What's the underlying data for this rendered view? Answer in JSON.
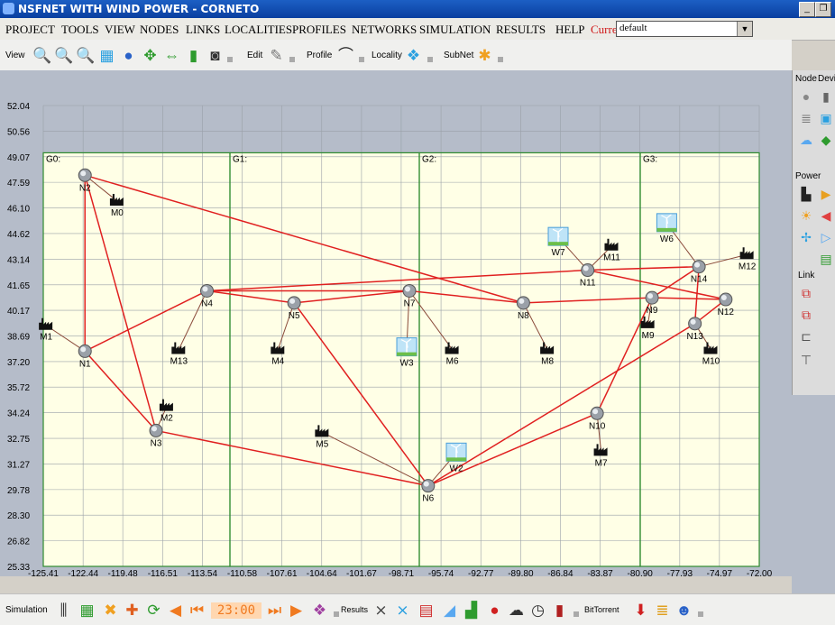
{
  "window": {
    "title": "NSFNET WITH WIND POWER - CORNETO"
  },
  "menu": {
    "items": [
      "PROJECT",
      "TOOLS",
      "VIEW",
      "NODES",
      "LINKS",
      "LOCALITIES",
      "PROFILES",
      "NETWORKS",
      "SIMULATION",
      "RESULTS",
      "HELP"
    ],
    "current_network_label": "Current Network",
    "current_network_value": "default"
  },
  "toolbar": {
    "view_label": "View",
    "edit_label": "Edit",
    "profile_label": "Profile",
    "locality_label": "Locality",
    "subnet_label": "SubNet"
  },
  "side_panel": {
    "node_tab": "Node",
    "device_tab": "Devi",
    "power_label": "Power",
    "link_label": "Link"
  },
  "bottom": {
    "simulation_label": "Simulation",
    "timer_display": "23:00",
    "results_label": "Results",
    "bittorrent_label": "BitTorrent"
  },
  "map": {
    "y_ticks": [
      "52.04",
      "50.56",
      "49.07",
      "47.59",
      "46.10",
      "44.62",
      "43.14",
      "41.65",
      "40.17",
      "38.69",
      "37.20",
      "35.72",
      "34.24",
      "32.75",
      "31.27",
      "29.78",
      "28.30",
      "26.82",
      "25.33"
    ],
    "x_ticks": [
      "-125.41",
      "-122.44",
      "-119.48",
      "-116.51",
      "-113.54",
      "-110.58",
      "-107.61",
      "-104.64",
      "-101.67",
      "-98.71",
      "-95.74",
      "-92.77",
      "-89.80",
      "-86.84",
      "-83.87",
      "-80.90",
      "-77.93",
      "-74.97",
      "-72.00"
    ],
    "groups": [
      "G0:",
      "G1:",
      "G2:",
      "G3:"
    ],
    "nodes": [
      {
        "id": "N1",
        "lon": -122.3,
        "lat": 37.8
      },
      {
        "id": "N2",
        "lon": -122.3,
        "lat": 48.0
      },
      {
        "id": "N3",
        "lon": -117.0,
        "lat": 33.2
      },
      {
        "id": "N4",
        "lon": -113.2,
        "lat": 41.3
      },
      {
        "id": "N5",
        "lon": -106.7,
        "lat": 40.6
      },
      {
        "id": "N6",
        "lon": -96.7,
        "lat": 30.0
      },
      {
        "id": "N7",
        "lon": -98.1,
        "lat": 41.3
      },
      {
        "id": "N8",
        "lon": -89.6,
        "lat": 40.6
      },
      {
        "id": "N9",
        "lon": -80.0,
        "lat": 40.9
      },
      {
        "id": "N10",
        "lon": -84.1,
        "lat": 34.2
      },
      {
        "id": "N11",
        "lon": -84.8,
        "lat": 42.5
      },
      {
        "id": "N12",
        "lon": -74.5,
        "lat": 40.8
      },
      {
        "id": "N13",
        "lon": -76.8,
        "lat": 39.4
      },
      {
        "id": "N14",
        "lon": -76.5,
        "lat": 42.7
      }
    ],
    "power_plants": [
      {
        "id": "M0",
        "lon": -119.9,
        "lat": 46.5
      },
      {
        "id": "M1",
        "lon": -125.2,
        "lat": 39.3
      },
      {
        "id": "M2",
        "lon": -116.2,
        "lat": 34.6
      },
      {
        "id": "M4",
        "lon": -107.9,
        "lat": 37.9
      },
      {
        "id": "M5",
        "lon": -104.6,
        "lat": 33.1
      },
      {
        "id": "M6",
        "lon": -94.9,
        "lat": 37.9
      },
      {
        "id": "M7",
        "lon": -83.8,
        "lat": 32.0
      },
      {
        "id": "M8",
        "lon": -87.8,
        "lat": 37.9
      },
      {
        "id": "M9",
        "lon": -80.3,
        "lat": 39.4
      },
      {
        "id": "M10",
        "lon": -75.6,
        "lat": 37.9
      },
      {
        "id": "M11",
        "lon": -83.0,
        "lat": 43.9
      },
      {
        "id": "M12",
        "lon": -72.9,
        "lat": 43.4
      },
      {
        "id": "M13",
        "lon": -115.3,
        "lat": 37.9
      }
    ],
    "wind_farms": [
      {
        "id": "W2",
        "lon": -94.6,
        "lat": 31.9
      },
      {
        "id": "W3",
        "lon": -98.3,
        "lat": 38.0
      },
      {
        "id": "W6",
        "lon": -78.9,
        "lat": 45.2
      },
      {
        "id": "W7",
        "lon": -87.0,
        "lat": 44.4
      }
    ],
    "links": [
      [
        "N1",
        "N2"
      ],
      [
        "N1",
        "N3"
      ],
      [
        "N1",
        "N4"
      ],
      [
        "N2",
        "N3"
      ],
      [
        "N2",
        "N8"
      ],
      [
        "N3",
        "N6"
      ],
      [
        "N4",
        "N5"
      ],
      [
        "N4",
        "N11"
      ],
      [
        "N4",
        "N7"
      ],
      [
        "N5",
        "N6"
      ],
      [
        "N5",
        "N7"
      ],
      [
        "N6",
        "N10"
      ],
      [
        "N6",
        "N13"
      ],
      [
        "N7",
        "N8"
      ],
      [
        "N8",
        "N9"
      ],
      [
        "N9",
        "N10"
      ],
      [
        "N9",
        "N12"
      ],
      [
        "N9",
        "N14"
      ],
      [
        "N11",
        "N12"
      ],
      [
        "N12",
        "N13"
      ],
      [
        "N13",
        "N14"
      ],
      [
        "N11",
        "N14"
      ]
    ],
    "feeders": [
      [
        "M0",
        "N2"
      ],
      [
        "M1",
        "N1"
      ],
      [
        "M2",
        "N3"
      ],
      [
        "M4",
        "N5"
      ],
      [
        "M5",
        "N6"
      ],
      [
        "M6",
        "N7"
      ],
      [
        "M7",
        "N10"
      ],
      [
        "M8",
        "N8"
      ],
      [
        "M9",
        "N9"
      ],
      [
        "M10",
        "N13"
      ],
      [
        "M11",
        "N11"
      ],
      [
        "M12",
        "N14"
      ],
      [
        "M13",
        "N4"
      ],
      [
        "W2",
        "N6"
      ],
      [
        "W3",
        "N7"
      ],
      [
        "W6",
        "N14"
      ],
      [
        "W7",
        "N11"
      ]
    ]
  },
  "colors": {
    "link": "#e02020",
    "feeder": "#8a4a3a",
    "map_bg": "#ffffe6",
    "outer_bg": "#b5bcc9",
    "group_border": "#2e8b2e",
    "grid": "#9aa0a8"
  }
}
